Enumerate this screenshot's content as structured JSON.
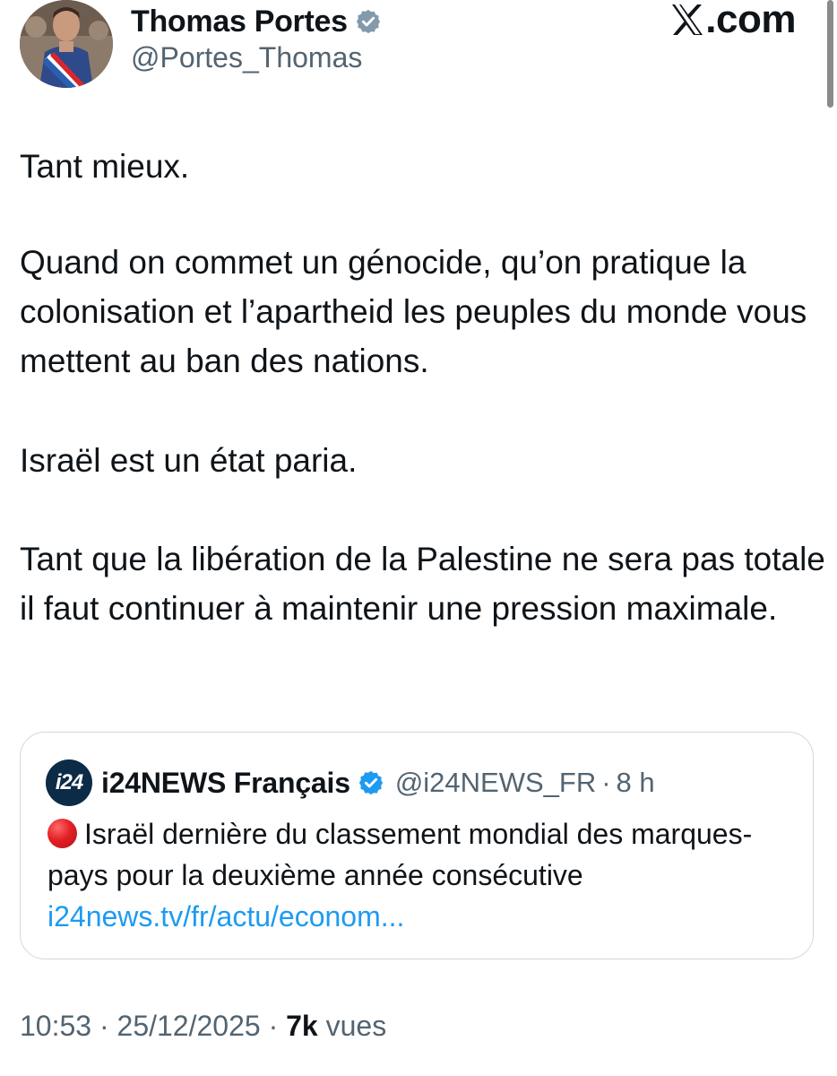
{
  "author": {
    "name": "Thomas Portes",
    "handle": "@Portes_Thomas",
    "verified": true,
    "avatar_icon": "profile-photo"
  },
  "brand": {
    "x_icon": "x-logo-icon",
    "suffix": ".com"
  },
  "tweet": {
    "paragraphs": [
      "Tant mieux.",
      "Quand on commet un génocide, qu’on pratique la colonisation et l’apartheid les peuples du monde vous mettent au ban des nations.",
      "Israël est un état paria.",
      "Tant que la libération de la Palestine ne sera pas totale il faut continuer à maintenir une pression maximale."
    ]
  },
  "quote": {
    "avatar_text": "i24",
    "name": "i24NEWS Français",
    "verified": true,
    "handle": "@i24NEWS_FR",
    "separator": "·",
    "time": "8 h",
    "emoji": "red-circle-icon",
    "text": "Israël dernière du classement mondial des marques-pays pour la deuxième année consécutive",
    "link": "i24news.tv/fr/actu/econom..."
  },
  "footer": {
    "time": "10:53",
    "separator1": " · ",
    "date": "25/12/2025",
    "separator2": " · ",
    "views_count": "7k",
    "views_label": " vues"
  },
  "colors": {
    "text": "#0f1419",
    "secondary": "#536471",
    "link": "#1d9bf0",
    "verified": "#1d9bf0",
    "border": "#cfd9de"
  }
}
